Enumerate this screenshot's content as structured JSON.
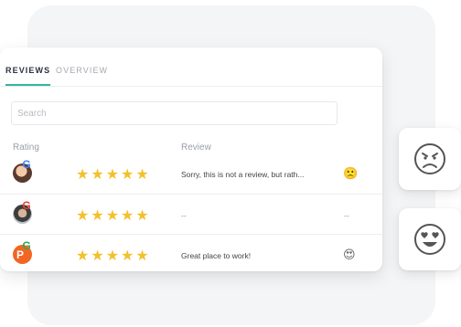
{
  "tabs": {
    "reviews": "REVIEWS",
    "overview": "OVERVIEW"
  },
  "search": {
    "placeholder": "Search"
  },
  "columns": {
    "rating": "Rating",
    "review": "Review"
  },
  "rows": [
    {
      "rating": 5,
      "stars": "★★★★★",
      "text": "Sorry, this is not a review, but rath...",
      "reaction": "neutral",
      "reaction_glyph": "🙁"
    },
    {
      "rating": 5,
      "stars": "★★★★★",
      "text": "--",
      "reaction": "none",
      "reaction_text": "--"
    },
    {
      "rating": 5,
      "stars": "★★★★★",
      "text": "Great place to work!",
      "reaction": "love",
      "reaction_glyph": "😍"
    }
  ],
  "side_faces": [
    {
      "icon": "sad-face-icon"
    },
    {
      "icon": "heart-eyes-face-icon"
    }
  ],
  "colors": {
    "accent": "#2fb7a0",
    "star": "#f2c12e",
    "google_badge": [
      "#4285f4",
      "#ea4335",
      "#fbbc05",
      "#34a853"
    ]
  }
}
